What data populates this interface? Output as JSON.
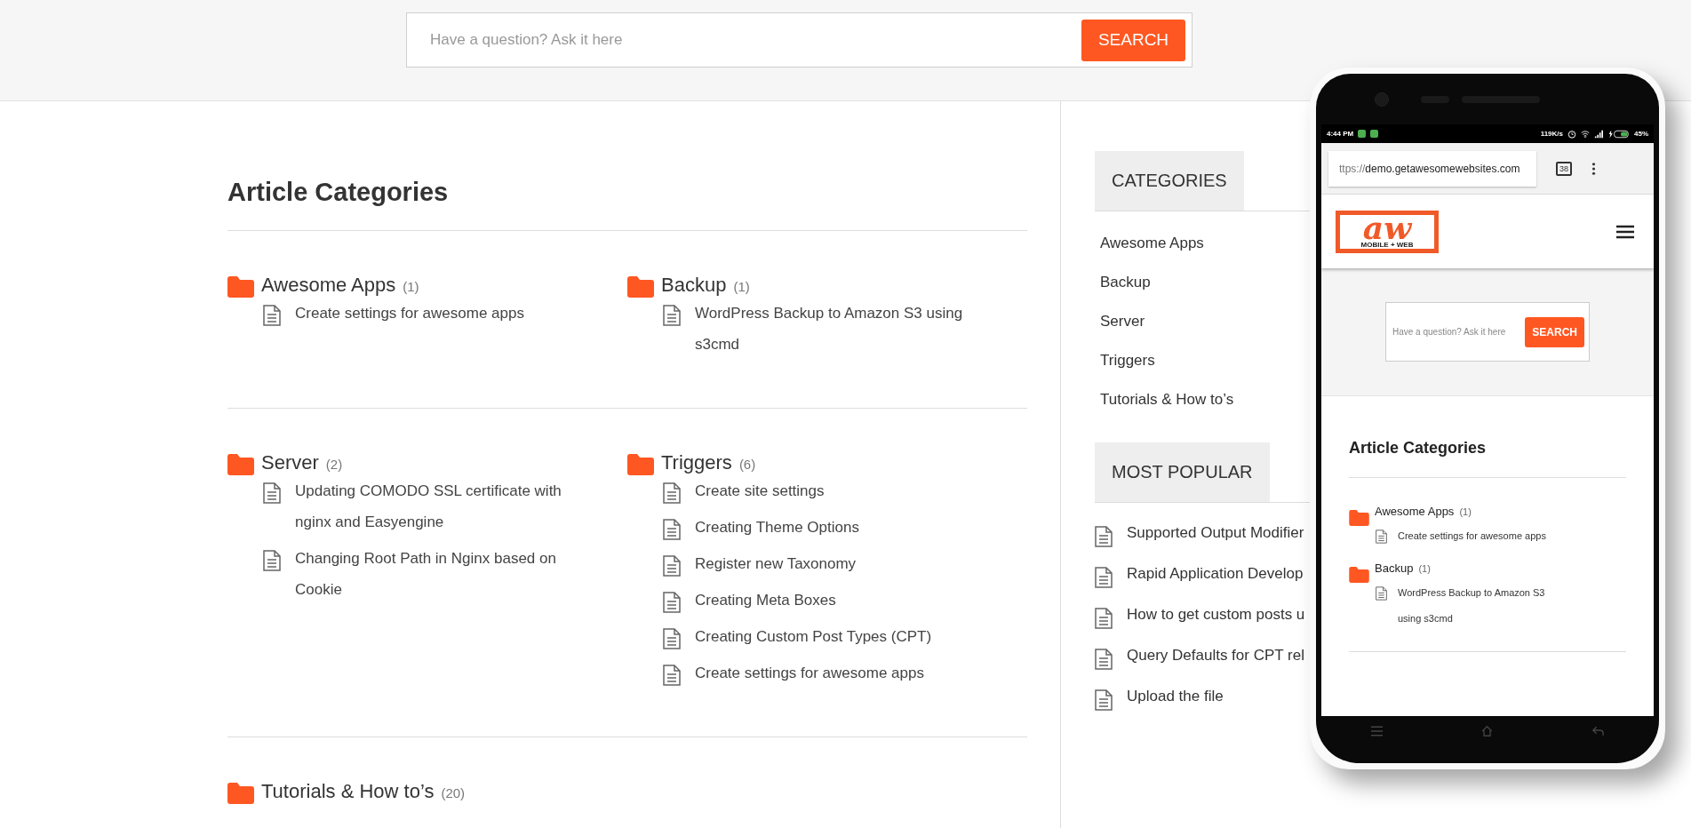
{
  "search": {
    "placeholder": "Have a question? Ask it here",
    "button": "SEARCH"
  },
  "main": {
    "title": "Article Categories",
    "rows": [
      {
        "categories": [
          {
            "name": "Awesome Apps",
            "count": "(1)",
            "articles": [
              "Create settings for awesome apps"
            ]
          },
          {
            "name": "Backup",
            "count": "(1)",
            "articles": [
              "WordPress Backup to Amazon S3 using s3cmd"
            ]
          }
        ]
      },
      {
        "categories": [
          {
            "name": "Server",
            "count": "(2)",
            "articles": [
              "Updating COMODO SSL certificate with nginx and Easyengine",
              "Changing Root Path in Nginx based on Cookie"
            ]
          },
          {
            "name": "Triggers",
            "count": "(6)",
            "articles": [
              "Create site settings",
              "Creating Theme Options",
              "Register new Taxonomy",
              "Creating Meta Boxes",
              "Creating Custom Post Types (CPT)",
              "Create settings for awesome apps"
            ]
          }
        ]
      },
      {
        "categories": [
          {
            "name": "Tutorials & How to’s",
            "count": "(20)"
          }
        ]
      }
    ]
  },
  "sidebar": {
    "categories": {
      "title": "CATEGORIES",
      "items": [
        "Awesome Apps",
        "Backup",
        "Server",
        "Triggers",
        "Tutorials & How to’s"
      ]
    },
    "most_popular": {
      "title": "MOST POPULAR",
      "items": [
        "Supported Output Modifier",
        "Rapid Application Develop",
        "How to get custom posts u",
        "Query Defaults for CPT rel",
        "Upload the file"
      ]
    }
  },
  "phone": {
    "status_bar": {
      "time": "4:44 PM",
      "speed": "119K/s",
      "battery": "45%"
    },
    "browser": {
      "url_scheme": "ttps://",
      "url_host": "demo.getawesomewebsites.com",
      "tab_count": "38"
    },
    "logo": {
      "mark": "aw",
      "tagline": "MOBILE + WEB"
    },
    "search": {
      "placeholder": "Have a question? Ask it here",
      "button": "SEARCH"
    },
    "title": "Article Categories",
    "categories": [
      {
        "name": "Awesome Apps",
        "count": "(1)",
        "articles": [
          "Create settings for awesome apps"
        ]
      },
      {
        "name": "Backup",
        "count": "(1)",
        "articles": [
          "WordPress Backup to Amazon S3 using s3cmd"
        ]
      }
    ]
  }
}
